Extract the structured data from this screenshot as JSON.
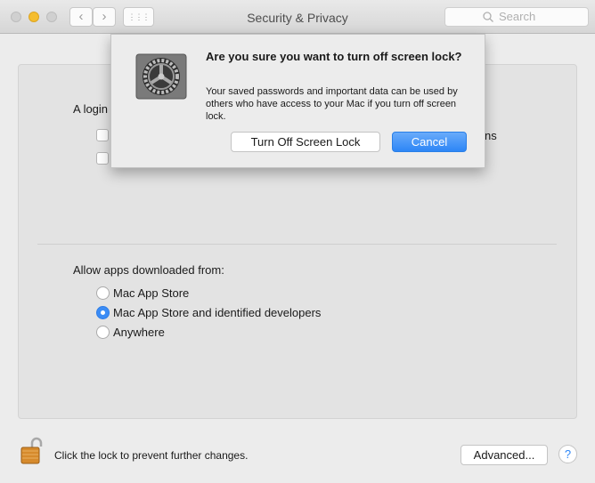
{
  "window": {
    "title": "Security & Privacy",
    "search_placeholder": "Search",
    "back": "‹",
    "forward": "›",
    "grid": "⋮⋮⋮"
  },
  "general": {
    "login_label_partial": "A login",
    "option_partial_suffix": "ns"
  },
  "downloads": {
    "label": "Allow apps downloaded from:",
    "options": [
      {
        "label": "Mac App Store",
        "selected": false
      },
      {
        "label": "Mac App Store and identified developers",
        "selected": true
      },
      {
        "label": "Anywhere",
        "selected": false
      }
    ]
  },
  "footer": {
    "lock_text": "Click the lock to prevent further changes.",
    "advanced": "Advanced...",
    "help": "?"
  },
  "dialog": {
    "title": "Are you sure you want to turn off screen lock?",
    "message": "Your saved passwords and important data can be used by others who have access to your Mac if you turn off screen lock.",
    "confirm": "Turn Off Screen Lock",
    "cancel": "Cancel"
  },
  "colors": {
    "accent": "#2d86f6",
    "minimize": "#f5bd2f"
  }
}
